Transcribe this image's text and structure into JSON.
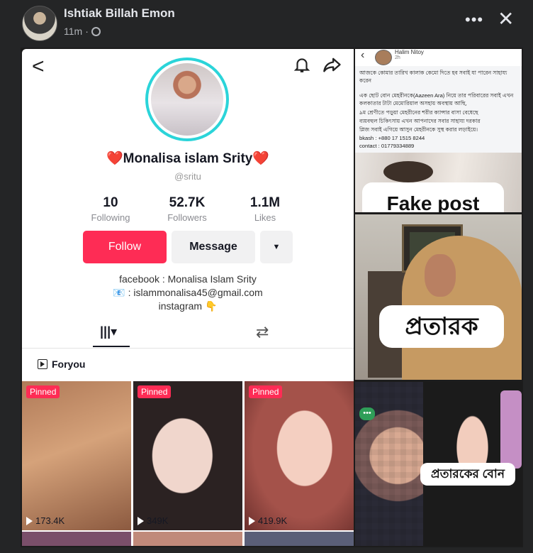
{
  "post": {
    "author": "Ishtiak Billah Emon",
    "time": "11m",
    "separator": "·",
    "privacy_icon": "globe-icon",
    "more_label": "•••",
    "close_label": "✕"
  },
  "tiktok": {
    "back_label": "<",
    "heart_left": "❤️",
    "display_name": "Monalisa islam Srity",
    "heart_right": "❤️",
    "handle": "@sritu",
    "stats": [
      {
        "value": "10",
        "label": "Following"
      },
      {
        "value": "52.7K",
        "label": "Followers"
      },
      {
        "value": "1.1M",
        "label": "Likes"
      }
    ],
    "follow_label": "Follow",
    "message_label": "Message",
    "more_label": "▼",
    "bio_lines": [
      "facebook : Monalisa Islam Srity",
      "📧 : islammonalisa45@gmail.com",
      "instagram 👇"
    ],
    "tab_grid_label": "|||▾",
    "tab_repost_label": "⇄",
    "foryou_label": "Foryou",
    "videos": [
      {
        "pinned": "Pinned",
        "views": "173.4K"
      },
      {
        "pinned": "Pinned",
        "views": "349K"
      },
      {
        "pinned": "Pinned",
        "views": "419.9K"
      }
    ]
  },
  "screenshot_post": {
    "name": "Halim Nitoy",
    "time": "2h",
    "lines": [
      "আজকে কোমার তারিখ কালাক কেমো দিতে হব সবাই যা পারেন সাহায্য করেন",
      "এক ছোট বোন মেহরীনকে(Aazeen Ara) নিয়ে তার পরিবারের সবাই এখন কলকাতার টাটা মেমোরিয়াল অসহায় অবস্থায় আছি,",
      "৯ম শ্রেণীতে পড়ুয়া মেহরীনের শরীর ক্যান্সার বাসা বেধেছে",
      "ব্যয়বহুল চিকিৎসায় এখন আপনাদের সবার সাহায্য দরকার",
      "প্লিজ সবাই এগিয়ে আসুন মেহরীনকে সুস্থ করার লড়াইয়ে।",
      "bkash : +880 17 1515 8244",
      "contact : 01779334889"
    ],
    "overlay": "Fake post"
  },
  "panel2_overlay": "প্রতারক",
  "panel3": {
    "badge": "•••",
    "overlay": "প্রতারকের বোন"
  },
  "colors": {
    "background": "#242526",
    "tiktok_accent": "#fe2c55",
    "ring": "#2bd4d9"
  }
}
